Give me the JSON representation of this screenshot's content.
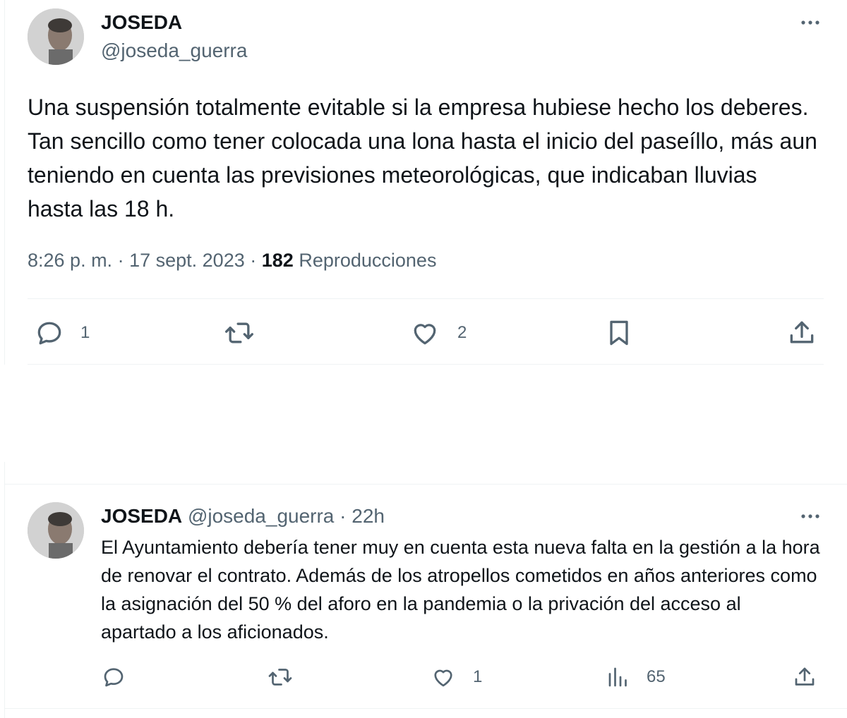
{
  "tweet1": {
    "name": "JOSEDA",
    "handle": "@joseda_guerra",
    "more_icon": "more-icon",
    "text": "Una suspensión totalmente evitable si la empresa hubiese hecho los deberes. Tan sencillo como tener colocada una lona hasta el inicio del paseíllo, más aun teniendo en cuenta las previsiones meteorológicas, que indicaban lluvias hasta las 18 h.",
    "time": "8:26 p. m.",
    "date": "17 sept. 2023",
    "views_count": "182",
    "views_label": "Reproducciones",
    "reply_count": "1",
    "like_count": "2"
  },
  "tweet2": {
    "name": "JOSEDA",
    "handle": "@joseda_guerra",
    "time": "22h",
    "text": "El Ayuntamiento debería tener muy en cuenta esta nueva falta en la gestión a la hora de renovar el contrato. Además de los atropellos cometidos en años anteriores como la asignación del 50 % del aforo en la pandemia o la privación del acceso al apartado a los aficionados.",
    "like_count": "1",
    "views_count": "65"
  },
  "icons": [
    "reply-icon",
    "retweet-icon",
    "like-icon",
    "bookmark-icon",
    "share-icon",
    "views-icon",
    "more-icon"
  ],
  "colors": {
    "text": "#0f1419",
    "secondary": "#536471",
    "divider": "#eff3f4"
  }
}
